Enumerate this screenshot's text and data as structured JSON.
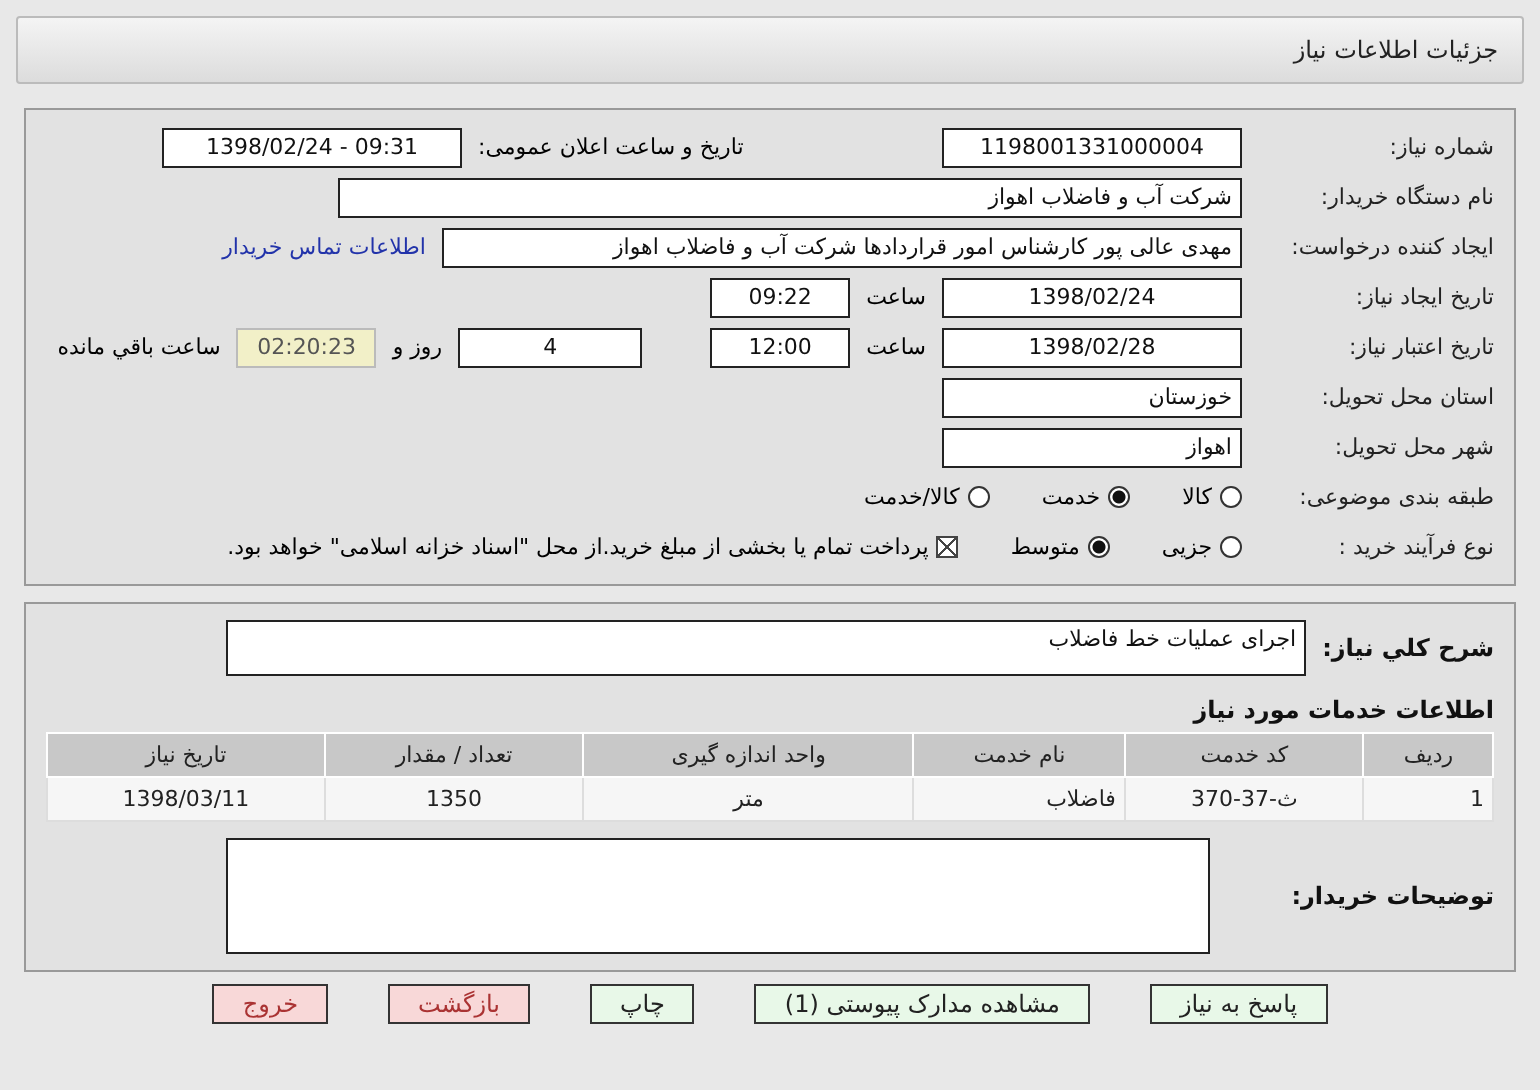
{
  "header": {
    "title": "جزئیات اطلاعات نیاز"
  },
  "form": {
    "need_number": {
      "label": "شماره نیاز:",
      "value": "1198001331000004"
    },
    "announce": {
      "label": "تاریخ و ساعت اعلان عمومی:",
      "value": "1398/02/24 - 09:31"
    },
    "buyer_org": {
      "label": "نام دستگاه خریدار:",
      "value": "شرکت آب و فاضلاب اهواز"
    },
    "requester": {
      "label": "ایجاد کننده درخواست:",
      "value": "مهدی عالی پور کارشناس امور قراردادها شرکت آب و فاضلاب اهواز",
      "link": "اطلاعات تماس خریدار"
    },
    "created": {
      "label": "تاریخ ایجاد نیاز:",
      "date": "1398/02/24",
      "time_label": "ساعت",
      "time": "09:22"
    },
    "validity": {
      "label": "تاریخ اعتبار نیاز:",
      "date": "1398/02/28",
      "time_label": "ساعت",
      "time": "12:00",
      "days": "4",
      "days_label": "روز و",
      "remaining": "02:20:23",
      "remaining_label": "ساعت باقي مانده"
    },
    "province": {
      "label": "استان محل تحویل:",
      "value": "خوزستان"
    },
    "city": {
      "label": "شهر محل تحویل:",
      "value": "اهواز"
    },
    "category": {
      "label": "طبقه بندی موضوعی:",
      "options": [
        {
          "label": "کالا",
          "selected": false
        },
        {
          "label": "خدمت",
          "selected": true
        },
        {
          "label": "کالا/خدمت",
          "selected": false
        }
      ]
    },
    "process": {
      "label": "نوع فرآیند خرید :",
      "options": [
        {
          "label": "جزیی",
          "selected": false
        },
        {
          "label": "متوسط",
          "selected": true
        }
      ],
      "treasury": {
        "label": "پرداخت تمام یا بخشی از مبلغ خرید.از محل \"اسناد خزانه اسلامی\" خواهد بود.",
        "checked": true
      }
    }
  },
  "summary": {
    "label": "شرح کلي نیاز:",
    "value": "اجرای عملیات خط فاضلاب"
  },
  "services": {
    "title": "اطلاعات خدمات مورد نیاز",
    "columns": [
      "ردیف",
      "کد خدمت",
      "نام خدمت",
      "واحد اندازه گیری",
      "تعداد / مقدار",
      "تاریخ نیاز"
    ],
    "rows": [
      [
        "1",
        "ث-37-370",
        "فاضلاب",
        "متر",
        "1350",
        "1398/03/11"
      ]
    ]
  },
  "notes": {
    "label": "توضیحات خریدار:"
  },
  "buttons": [
    {
      "label": "پاسخ به نیاز",
      "kind": "green"
    },
    {
      "label": "مشاهده مدارک پیوستی (1)",
      "kind": "green"
    },
    {
      "label": "چاپ",
      "kind": "green"
    },
    {
      "label": "بازگشت",
      "kind": "red"
    },
    {
      "label": "خروج",
      "kind": "red"
    }
  ]
}
